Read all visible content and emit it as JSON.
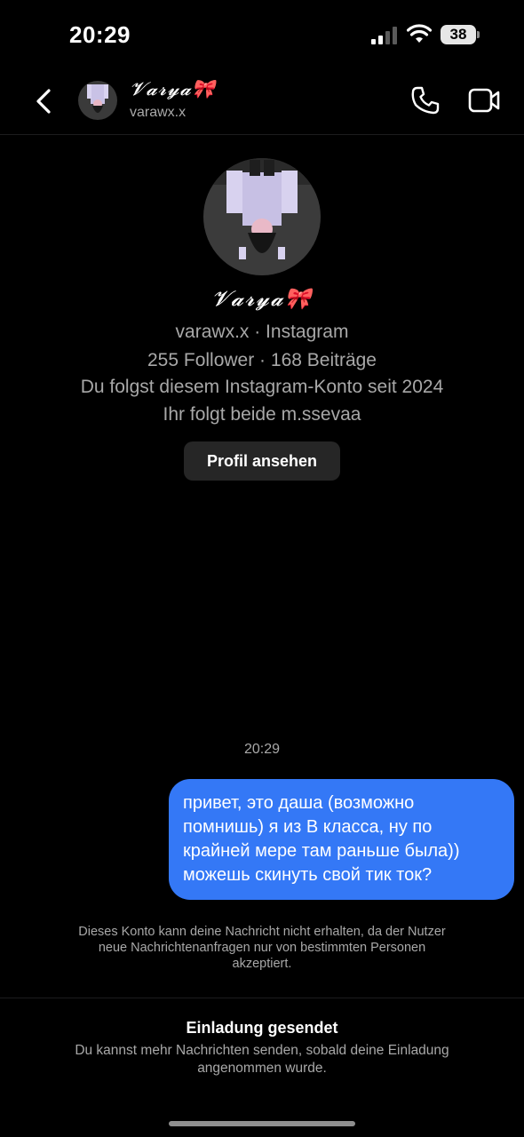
{
  "status_bar": {
    "time": "20:29",
    "battery": "38",
    "icons": [
      "cellular-signal-icon",
      "wifi-icon",
      "battery-icon"
    ]
  },
  "header": {
    "name": "𝓥𝓪𝓻𝔂𝓪🎀",
    "username": "varawx.x",
    "icons": [
      "chevron-left-icon",
      "phone-icon",
      "video-camera-icon"
    ]
  },
  "profile": {
    "name": "𝓥𝓪𝓻𝔂𝓪🎀",
    "username_platform": "varawx.x · Instagram",
    "stats": "255 Follower · 168 Beiträge",
    "following_since": "Du folgst diesem Instagram-Konto seit 2024",
    "mutual": "Ihr folgt beide m.ssevaa",
    "view_profile_label": "Profil ansehen"
  },
  "messages": {
    "timestamp": "20:29",
    "outgoing": [
      {
        "lines": [
          "привет, это даша (возможно",
          "помнишь) я из В класса, ну по",
          "крайней мере там раньше была))",
          "можешь скинуть свой тик ток?"
        ]
      }
    ],
    "notice": "Dieses Konto kann deine Nachricht nicht erhalten, da der Nutzer neue Nachrichtenanfragen nur von bestimmten Personen akzeptiert."
  },
  "invite": {
    "title": "Einladung gesendet",
    "subtitle": "Du kannst mehr Nachrichten senden, sobald deine Einladung angenommen wurde."
  },
  "colors": {
    "background": "#000000",
    "bubble": "#3478f6",
    "secondary_text": "#a8a8a8",
    "button_bg": "#262626"
  }
}
